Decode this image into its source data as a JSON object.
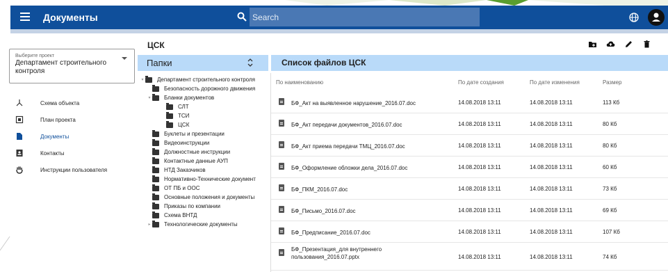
{
  "header": {
    "title": "Документы",
    "search_placeholder": "Search"
  },
  "project": {
    "label": "Выберите проект",
    "value": "Департамент строительного контроля"
  },
  "nav": [
    {
      "label": "Схема объекта",
      "icon": "schema-icon"
    },
    {
      "label": "План проекта",
      "icon": "plan-icon"
    },
    {
      "label": "Документы",
      "icon": "document-icon"
    },
    {
      "label": "Контакты",
      "icon": "contacts-icon"
    },
    {
      "label": "Инструкции пользователя",
      "icon": "hand-icon"
    }
  ],
  "section_title": "ЦСК",
  "folders": {
    "title": "Папки",
    "items": [
      {
        "name": "Департамент строительного контроля",
        "level": 0,
        "arrow": "▾"
      },
      {
        "name": "Безопасность дорожного движения",
        "level": 1,
        "arrow": ""
      },
      {
        "name": "Бланки документов",
        "level": 1,
        "arrow": "▾"
      },
      {
        "name": "СЛТ",
        "level": 2,
        "arrow": ""
      },
      {
        "name": "ТСИ",
        "level": 2,
        "arrow": ""
      },
      {
        "name": "ЦСК",
        "level": 2,
        "arrow": ""
      },
      {
        "name": "Буклеты и презентации",
        "level": 1,
        "arrow": ""
      },
      {
        "name": "Видеоинструкции",
        "level": 1,
        "arrow": ""
      },
      {
        "name": "Должностные инструкции",
        "level": 1,
        "arrow": ""
      },
      {
        "name": "Контактные данные АУП",
        "level": 1,
        "arrow": ""
      },
      {
        "name": "НТД Заказчиков",
        "level": 1,
        "arrow": ""
      },
      {
        "name": "Нормативно-Технические документ",
        "level": 1,
        "arrow": ""
      },
      {
        "name": "ОТ ПБ и ООС",
        "level": 1,
        "arrow": ""
      },
      {
        "name": "Основные положения и документы",
        "level": 1,
        "arrow": ""
      },
      {
        "name": "Приказы по компании",
        "level": 1,
        "arrow": ""
      },
      {
        "name": "Схема ВНТД",
        "level": 1,
        "arrow": ""
      },
      {
        "name": "Технологические документы",
        "level": 1,
        "arrow": "▸"
      }
    ]
  },
  "files": {
    "title": "Список файлов ЦСК",
    "columns": {
      "name": "По наименованию",
      "created": "По дате создания",
      "modified": "По дате изменения",
      "size": "Размер"
    },
    "rows": [
      {
        "name": "БФ_Акт на выявленное нарушение_2016.07.doc",
        "created": "14.08.2018 13:11",
        "modified": "14.08.2018 13:11",
        "size": "113 Кб"
      },
      {
        "name": "БФ_Акт передачи документов_2016.07.doc",
        "created": "14.08.2018 13:11",
        "modified": "14.08.2018 13:11",
        "size": "80 Кб"
      },
      {
        "name": "БФ_Акт приема передачи ТМЦ_2016.07.doc",
        "created": "14.08.2018 13:11",
        "modified": "14.08.2018 13:11",
        "size": "80 Кб"
      },
      {
        "name": "БФ_Оформление обложки дела_2016.07.doc",
        "created": "14.08.2018 13:11",
        "modified": "14.08.2018 13:11",
        "size": "60 Кб"
      },
      {
        "name": "БФ_ПКМ_2016.07.doc",
        "created": "14.08.2018 13:11",
        "modified": "14.08.2018 13:11",
        "size": "73 Кб"
      },
      {
        "name": "БФ_Письмо_2016.07.doc",
        "created": "14.08.2018 13:11",
        "modified": "14.08.2018 13:11",
        "size": "69 Кб"
      },
      {
        "name": "БФ_Предписание_2016.07.doc",
        "created": "14.08.2018 13:11",
        "modified": "14.08.2018 13:11",
        "size": "107 Кб"
      },
      {
        "name": "БФ_Презентация_для внутреннего пользования_2016.07.pptx",
        "created": "14.08.2018 13:11",
        "modified": "14.08.2018 13:11",
        "size": "74 Кб"
      }
    ]
  },
  "colors": {
    "topbar": "#0f4f9b",
    "panel_header": "#b9daf9",
    "active_nav": "#0f4f9b"
  }
}
